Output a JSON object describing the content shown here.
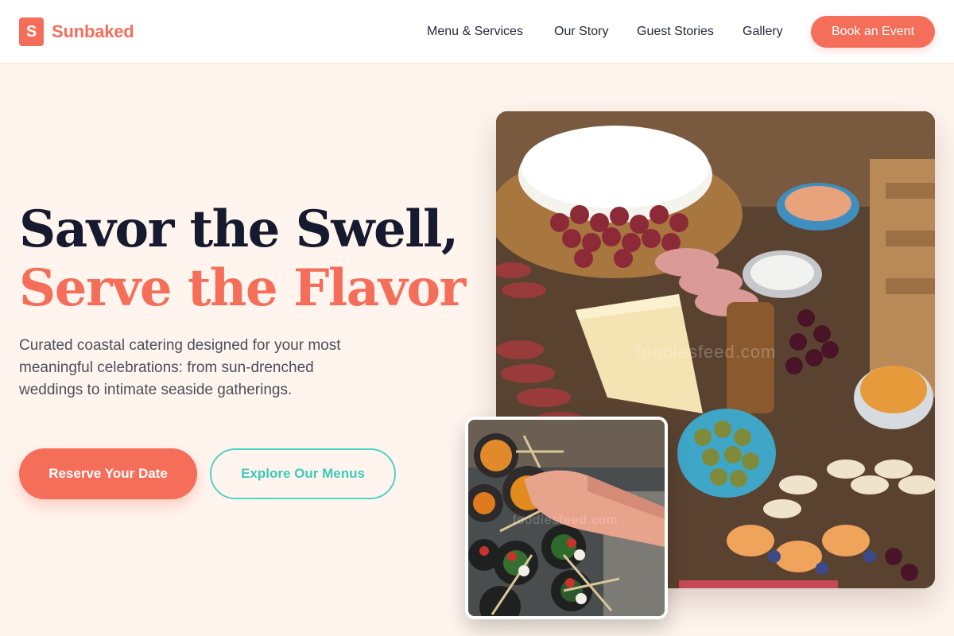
{
  "brand": {
    "mark": "S",
    "name": "Sunbaked",
    "accent": "#f46e5a",
    "secondary": "#4fd3c4"
  },
  "nav": {
    "items": [
      "Menu & Services",
      "Our Story",
      "Guest Stories",
      "Gallery"
    ],
    "cta": "Book an Event"
  },
  "hero": {
    "title_line1": "Savor the Swell,",
    "title_line2": "Serve the Flavor",
    "subtitle": "Curated coastal catering designed for your most meaningful celebrations: from sun-drenched weddings to intimate seaside gatherings.",
    "primary_cta": "Reserve Your Date",
    "secondary_cta": "Explore Our Menus"
  },
  "images": {
    "main_watermark": "foodiesfeed.com",
    "small_watermark": "foodiesfeed.com"
  }
}
